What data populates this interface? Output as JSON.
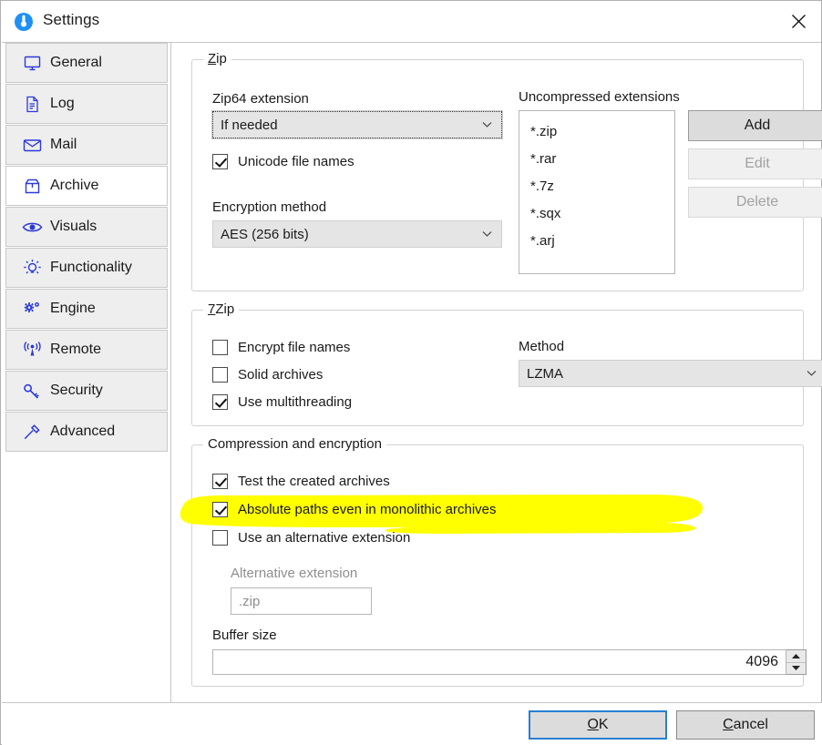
{
  "window": {
    "title": "Settings",
    "icon": "disc-lock-icon",
    "close_icon": "close-icon",
    "accent": "#2a7fd4",
    "highlight_color": "#ffff00"
  },
  "sidebar": {
    "items": [
      {
        "label": "General",
        "icon": "monitor-icon",
        "selected": false
      },
      {
        "label": "Log",
        "icon": "document-icon",
        "selected": false
      },
      {
        "label": "Mail",
        "icon": "envelope-icon",
        "selected": false
      },
      {
        "label": "Archive",
        "icon": "box-icon",
        "selected": true
      },
      {
        "label": "Visuals",
        "icon": "eye-icon",
        "selected": false
      },
      {
        "label": "Functionality",
        "icon": "bulb-icon",
        "selected": false
      },
      {
        "label": "Engine",
        "icon": "gears-icon",
        "selected": false
      },
      {
        "label": "Remote",
        "icon": "antenna-icon",
        "selected": false
      },
      {
        "label": "Security",
        "icon": "key-icon",
        "selected": false
      },
      {
        "label": "Advanced",
        "icon": "hammer-icon",
        "selected": false
      }
    ]
  },
  "zip_group": {
    "title": "Zip",
    "title_accel": "Z",
    "title_rest": "ip",
    "zip64_label": "Zip64 extension",
    "zip64_value": "If needed",
    "unicode_label": "Unicode file names",
    "unicode_checked": true,
    "encryption_label": "Encryption method",
    "encryption_value": "AES (256 bits)",
    "uncompressed_label": "Uncompressed extensions",
    "extensions": [
      "*.zip",
      "*.rar",
      "*.7z",
      "*.sqx",
      "*.arj"
    ],
    "add_label": "Add",
    "edit_label": "Edit",
    "delete_label": "Delete",
    "add_enabled": true,
    "edit_enabled": false,
    "delete_enabled": false
  },
  "sevenzip_group": {
    "title": "7Zip",
    "title_accel": "7",
    "title_rest": "Zip",
    "encrypt_names_label": "Encrypt file names",
    "encrypt_names_checked": false,
    "solid_label": "Solid archives",
    "solid_checked": false,
    "multithreading_label": "Use multithreading",
    "multithreading_checked": true,
    "method_label": "Method",
    "method_value": "LZMA"
  },
  "compression_group": {
    "title": "Compression and encryption",
    "test_label": "Test the created archives",
    "test_checked": true,
    "absolute_label": "Absolute paths even in monolithic archives",
    "absolute_checked": true,
    "absolute_highlighted": true,
    "alt_ext_label": "Use an alternative extension",
    "alt_ext_checked": false,
    "alt_ext_field_label": "Alternative extension",
    "alt_ext_value": ".zip",
    "alt_ext_enabled": false,
    "buffer_label": "Buffer size",
    "buffer_value": "4096"
  },
  "footer": {
    "ok_accel": "O",
    "ok_rest": "K",
    "ok_label": "OK",
    "cancel_accel": "C",
    "cancel_rest": "ancel",
    "cancel_label": "Cancel"
  }
}
